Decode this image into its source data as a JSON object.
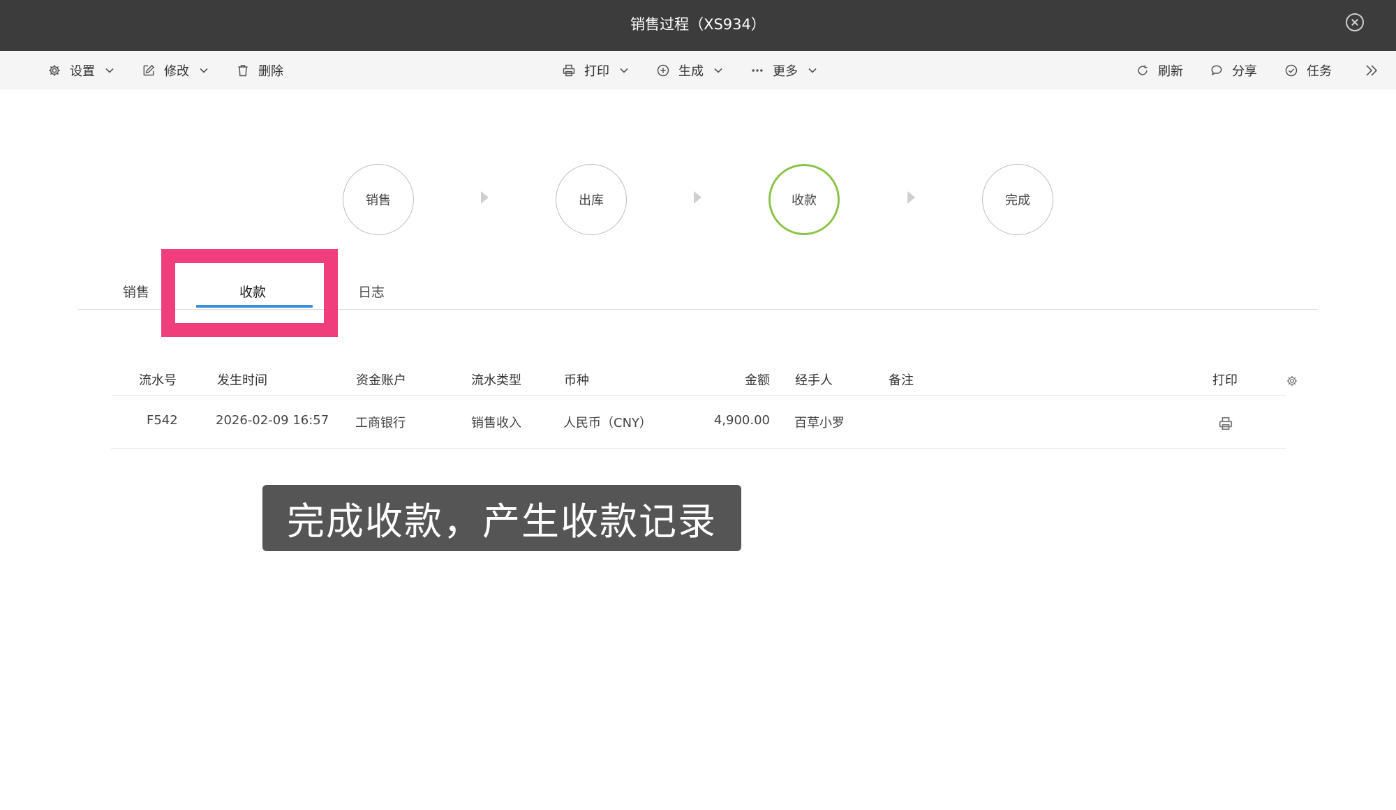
{
  "window": {
    "title": "销售过程（XS934）"
  },
  "toolbar": {
    "left": [
      {
        "label": "设置",
        "icon": "gear-icon"
      },
      {
        "label": "修改",
        "icon": "edit-icon"
      },
      {
        "label": "删除",
        "icon": "trash-icon"
      }
    ],
    "center": [
      {
        "label": "打印",
        "icon": "printer-icon"
      },
      {
        "label": "生成",
        "icon": "plus-circle-icon"
      },
      {
        "label": "更多",
        "icon": "more-dots-icon"
      }
    ],
    "right": [
      {
        "label": "刷新",
        "icon": "refresh-icon"
      },
      {
        "label": "分享",
        "icon": "chat-bubble-icon"
      },
      {
        "label": "任务",
        "icon": "check-circle-icon"
      }
    ],
    "expand_icon": "double-chevron-right-icon"
  },
  "steps": [
    {
      "label": "销售",
      "active": false
    },
    {
      "label": "出库",
      "active": false
    },
    {
      "label": "收款",
      "active": true
    },
    {
      "label": "完成",
      "active": false
    }
  ],
  "tabs": [
    {
      "label": "销售",
      "active": false
    },
    {
      "label": "收款",
      "active": true
    },
    {
      "label": "日志",
      "active": false
    }
  ],
  "table": {
    "columns": [
      "流水号",
      "发生时间",
      "资金账户",
      "流水类型",
      "币种",
      "金额",
      "经手人",
      "备注",
      "打印"
    ],
    "rows": [
      {
        "id": "F542",
        "time": "2026-02-09 16:57",
        "account": "工商银行",
        "type": "销售收入",
        "currency": "人民币（CNY）",
        "amount": "4,900.00",
        "handler": "百草小罗",
        "note": ""
      }
    ]
  },
  "caption": "完成收款，产生收款记录",
  "colors": {
    "titlebar": "#3c3c3c",
    "toolbar": "#f5f5f5",
    "active_step": "#8bc34a",
    "tab_underline": "#3a8fd9",
    "highlight": "#f03d7c"
  }
}
